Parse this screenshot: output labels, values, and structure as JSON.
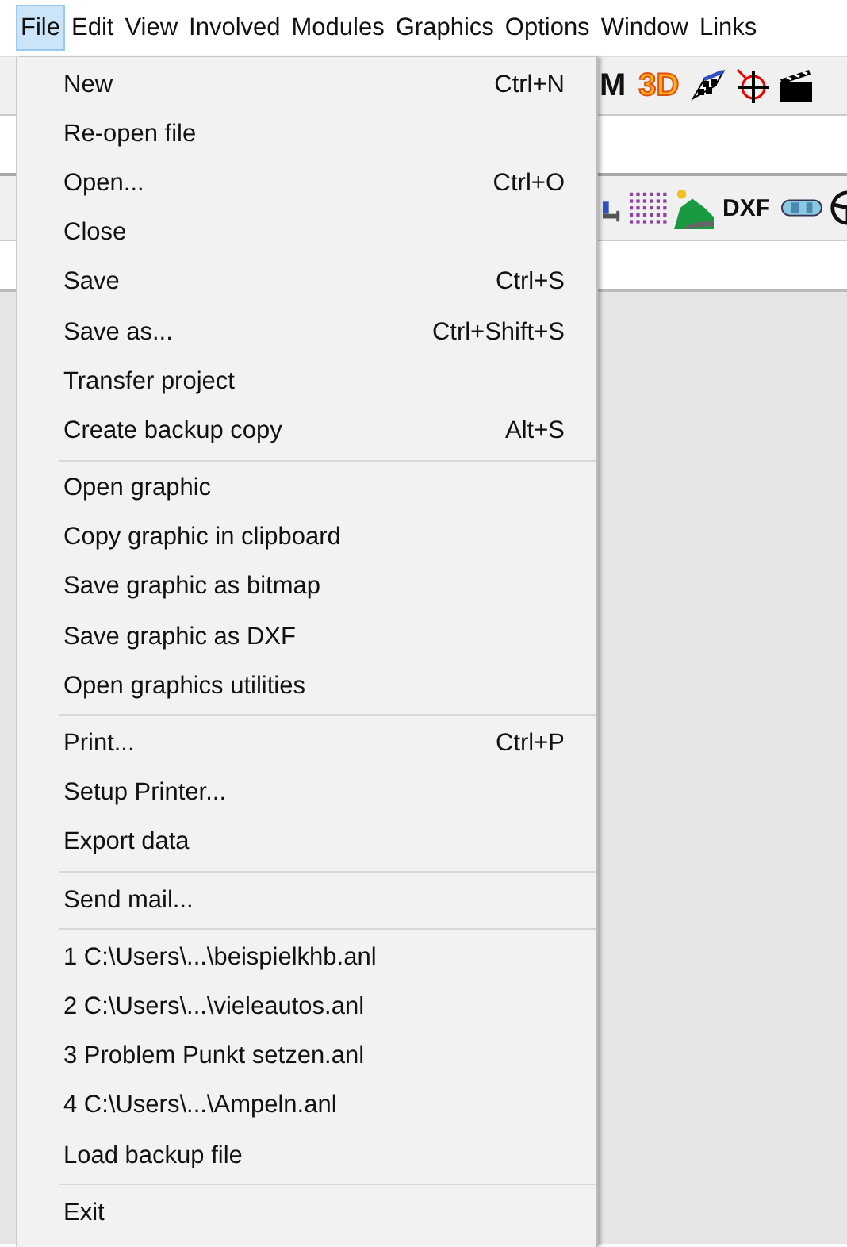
{
  "menubar": [
    {
      "label": "File",
      "selected": true
    },
    {
      "label": "Edit",
      "selected": false
    },
    {
      "label": "View",
      "selected": false
    },
    {
      "label": "Involved",
      "selected": false
    },
    {
      "label": "Modules",
      "selected": false
    },
    {
      "label": "Graphics",
      "selected": false
    },
    {
      "label": "Options",
      "selected": false
    },
    {
      "label": "Window",
      "selected": false
    },
    {
      "label": "Links",
      "selected": false
    }
  ],
  "toolbar_1": [
    {
      "kind": "letter",
      "label": "M"
    },
    {
      "kind": "letter3d",
      "label": "3D"
    },
    {
      "kind": "flag"
    },
    {
      "kind": "crosshair"
    },
    {
      "kind": "clapper"
    }
  ],
  "toolbar_2": [
    {
      "kind": "partial"
    },
    {
      "kind": "dots"
    },
    {
      "kind": "landscape"
    },
    {
      "kind": "letter",
      "label": "DXF"
    },
    {
      "kind": "car"
    },
    {
      "kind": "wheel"
    }
  ],
  "file_menu": [
    [
      {
        "label": "New",
        "shortcut": "Ctrl+N"
      },
      {
        "label": "Re-open file"
      },
      {
        "label": "Open...",
        "shortcut": "Ctrl+O"
      },
      {
        "label": "Close"
      },
      {
        "label": "Save",
        "shortcut": "Ctrl+S"
      },
      {
        "label": "Save as...",
        "shortcut": "Ctrl+Shift+S"
      },
      {
        "label": "Transfer project"
      },
      {
        "label": "Create backup copy",
        "shortcut": "Alt+S"
      }
    ],
    [
      {
        "label": "Open graphic"
      },
      {
        "label": "Copy graphic in clipboard"
      },
      {
        "label": "Save graphic as bitmap"
      },
      {
        "label": "Save graphic as DXF"
      },
      {
        "label": "Open graphics utilities"
      }
    ],
    [
      {
        "label": "Print...",
        "shortcut": "Ctrl+P"
      },
      {
        "label": "Setup Printer..."
      },
      {
        "label": "Export data"
      }
    ],
    [
      {
        "label": "Send mail..."
      }
    ],
    [
      {
        "label": "1 C:\\Users\\...\\beispielkhb.anl"
      },
      {
        "label": "2 C:\\Users\\...\\vieleautos.anl"
      },
      {
        "label": "3 Problem Punkt setzen.anl"
      },
      {
        "label": "4 C:\\Users\\...\\Ampeln.anl"
      },
      {
        "label": "Load backup file"
      }
    ],
    [
      {
        "label": "Exit"
      }
    ]
  ]
}
